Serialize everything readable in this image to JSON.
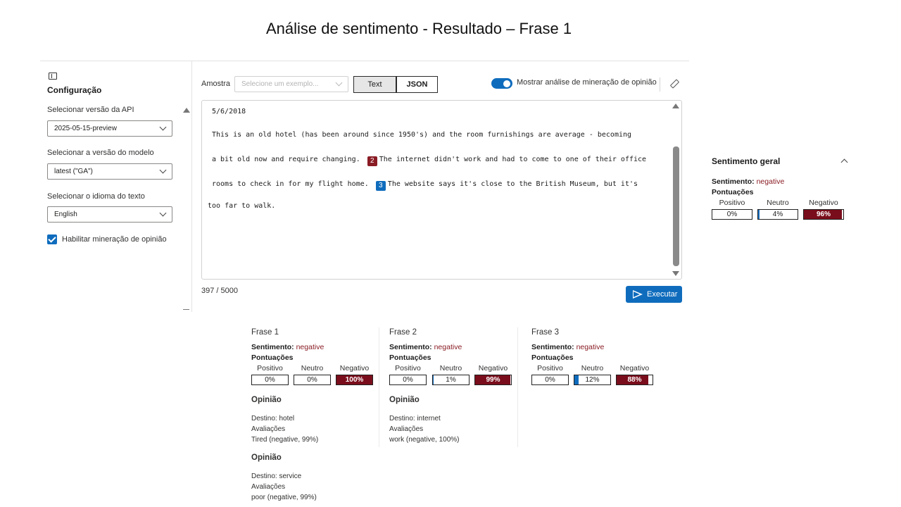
{
  "slide_title": "Análise de sentimento - Resultado – Frase 1",
  "sidebar": {
    "title": "Configuração",
    "api_version_label": "Selecionar versão da API",
    "api_version_value": "2025-05-15-preview",
    "model_version_label": "Selecionar a versão do modelo",
    "model_version_value": "latest (\"GA\")",
    "language_label": "Selecionar o idioma do texto",
    "language_value": "English",
    "opinion_mining_label": "Habilitar mineração de opinião",
    "opinion_mining_checked": true
  },
  "toolbar": {
    "sample_label": "Amostra",
    "sample_placeholder": "Selecione um exemplo...",
    "tab_text": "Text",
    "tab_json": "JSON",
    "toggle_label": "Mostrar análise de mineração de opinião",
    "toggle_on": true
  },
  "editor": {
    "line1": "5/6/2018",
    "line2": "This is an old hotel (has been around since 1950's) and the room furnishings are average - becoming",
    "line3a": "a bit old now and require changing.",
    "badge2": "2",
    "line3b": "The internet didn't work and had to come to one of their office",
    "line4a": "rooms to check in for my flight home.",
    "badge3": "3",
    "line4b": "The website says it's close to the British Museum, but it's",
    "line5": "too far to walk."
  },
  "char_count": "397 / 5000",
  "run_button": "Executar",
  "labels": {
    "sentiment": "Sentimento:",
    "scores": "Pontuações",
    "positive": "Positivo",
    "neutral": "Neutro",
    "negative": "Negativo",
    "opinion": "Opinião"
  },
  "overall": {
    "title": "Sentimento geral",
    "sentiment": "negative",
    "positive": "0%",
    "neutral": "4%",
    "negative": "96%",
    "neutral_frac": 0.04,
    "negative_frac": 0.96
  },
  "sentences": [
    {
      "title": "Frase 1",
      "sentiment": "negative",
      "positive": "0%",
      "neutral": "0%",
      "negative": "100%",
      "neutral_frac": 0,
      "negative_frac": 1.0,
      "opinions": [
        {
          "target": "Destino: hotel",
          "assessments": "Avaliações",
          "assessment": "Tired (negative, 99%)"
        },
        {
          "target": "Destino: service",
          "assessments": "Avaliações",
          "assessment": "poor (negative, 99%)"
        }
      ]
    },
    {
      "title": "Frase 2",
      "sentiment": "negative",
      "positive": "0%",
      "neutral": "1%",
      "negative": "99%",
      "neutral_frac": 0.01,
      "negative_frac": 0.99,
      "opinions": [
        {
          "target": "Destino: internet",
          "assessments": "Avaliações",
          "assessment": "work (negative, 100%)"
        }
      ]
    },
    {
      "title": "Frase 3",
      "sentiment": "negative",
      "positive": "0%",
      "neutral": "12%",
      "negative": "88%",
      "neutral_frac": 0.12,
      "negative_frac": 0.88,
      "opinions": []
    }
  ],
  "colors": {
    "accent": "#0f6cbd",
    "negative": "#7a0d1b",
    "negative_text": "#8a1c24"
  }
}
